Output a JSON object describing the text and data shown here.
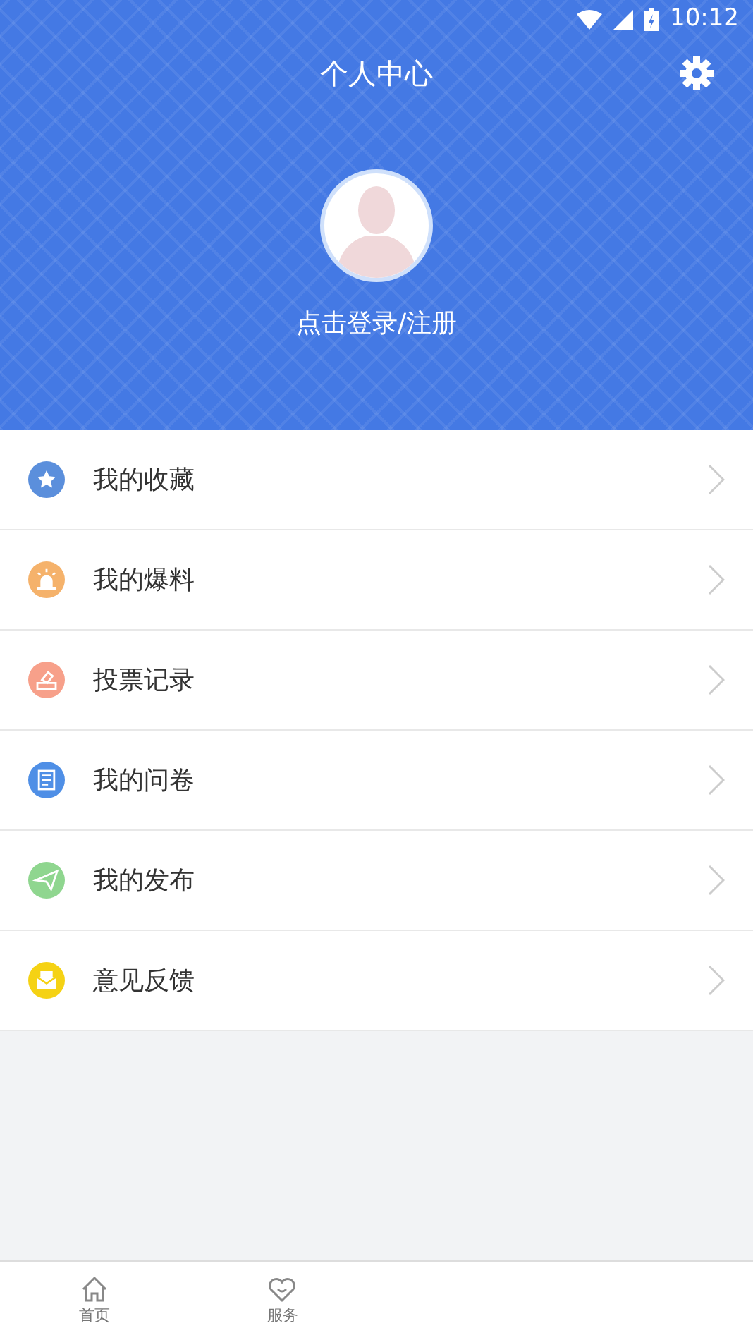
{
  "status_bar": {
    "time": "10:12"
  },
  "header": {
    "title": "个人中心",
    "login": "点击登录/注册"
  },
  "menu": [
    {
      "label": "我的收藏",
      "kind": "star",
      "color": "#5b8fdc"
    },
    {
      "label": "我的爆料",
      "kind": "alarm",
      "color": "#f5b26b"
    },
    {
      "label": "投票记录",
      "kind": "vote",
      "color": "#f7a08a"
    },
    {
      "label": "我的问卷",
      "kind": "survey",
      "color": "#4f8fe6"
    },
    {
      "label": "我的发布",
      "kind": "plane",
      "color": "#8fd68f"
    },
    {
      "label": "意见反馈",
      "kind": "mail",
      "color": "#f5d214"
    }
  ],
  "tab_bar": [
    {
      "label": "首页",
      "kind": "home"
    },
    {
      "label": "服务",
      "kind": "heart"
    }
  ]
}
